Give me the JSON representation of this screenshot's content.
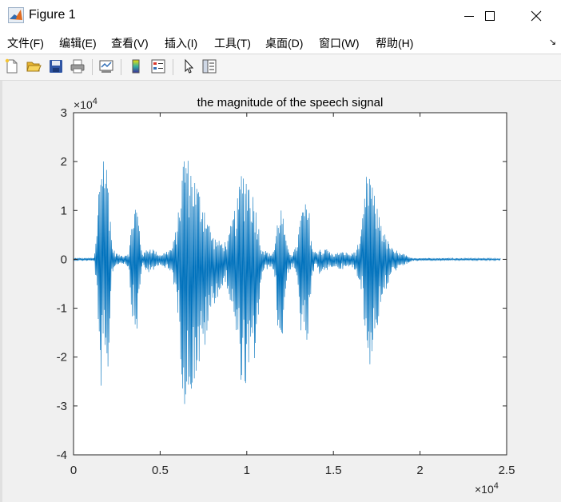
{
  "window": {
    "title": "Figure 1",
    "icon": "matlab-logo-icon",
    "controls": [
      "minimize-icon",
      "maximize-icon",
      "close-icon"
    ]
  },
  "menu": {
    "items": [
      "文件(F)",
      "编辑(E)",
      "查看(V)",
      "插入(I)",
      "工具(T)",
      "桌面(D)",
      "窗口(W)",
      "帮助(H)"
    ],
    "dock_glyph": "↘"
  },
  "toolbar": {
    "icons": [
      "new-figure-icon",
      "open-file-icon",
      "save-icon",
      "print-icon",
      "link-plot-icon",
      "colorbar-icon",
      "legend-icon",
      "edit-plot-arrow-icon",
      "property-editor-icon"
    ]
  },
  "colors": {
    "line": "#0072bd",
    "axes_bg": "#ffffff",
    "figure_bg": "#f0f0f0",
    "axis": "#262626"
  },
  "chart_data": {
    "type": "line",
    "title": "the magnitude of the speech signal",
    "xlabel": "",
    "ylabel": "",
    "xlim": [
      0,
      25000
    ],
    "ylim": [
      -40000,
      30000
    ],
    "x_ticks": [
      0,
      5000,
      10000,
      15000,
      20000,
      25000
    ],
    "x_tick_labels": [
      "0",
      "0.5",
      "1",
      "1.5",
      "2",
      "2.5"
    ],
    "y_ticks": [
      -40000,
      -30000,
      -20000,
      -10000,
      0,
      10000,
      20000,
      30000
    ],
    "y_tick_labels": [
      "-4",
      "-3",
      "-2",
      "-1",
      "0",
      "1",
      "2",
      "3"
    ],
    "x_exponent": {
      "base": "×10",
      "exp": "4"
    },
    "y_exponent": {
      "base": "×10",
      "exp": "4"
    },
    "grid": false,
    "sample_count": 24650,
    "envelope": {
      "x": [
        0,
        1200,
        1350,
        1500,
        1700,
        1800,
        1900,
        2000,
        2100,
        2200,
        2400,
        2700,
        3000,
        3200,
        3400,
        3600,
        3700,
        3800,
        3900,
        4000,
        4200,
        4500,
        4800,
        5000,
        5300,
        5700,
        6000,
        6200,
        6400,
        6600,
        6800,
        7000,
        7300,
        7600,
        7800,
        8000,
        8300,
        8600,
        8900,
        9200,
        9500,
        9700,
        10000,
        10200,
        10400,
        10600,
        10800,
        11000,
        11200,
        11400,
        11600,
        11800,
        12000,
        12300,
        12600,
        12900,
        13100,
        13300,
        13600,
        13800,
        14000,
        14200,
        14400,
        14600,
        14800,
        15000,
        15300,
        15700,
        16000,
        16300,
        16600,
        16900,
        17100,
        17300,
        17500,
        17700,
        17900,
        18100,
        18300,
        18500,
        18700,
        18900,
        19100,
        19300,
        19500,
        20000,
        24650
      ],
      "max": [
        300,
        300,
        6000,
        19000,
        24000,
        22000,
        20000,
        17000,
        13000,
        3000,
        1500,
        800,
        1000,
        1500,
        9000,
        12000,
        10000,
        7000,
        3000,
        1000,
        2000,
        2500,
        1500,
        1000,
        1500,
        2500,
        8000,
        15000,
        24000,
        21000,
        19000,
        17000,
        14000,
        11000,
        8000,
        5000,
        4000,
        3500,
        4000,
        9000,
        13000,
        19000,
        18000,
        16000,
        13000,
        10000,
        3000,
        2000,
        1500,
        1000,
        2500,
        9000,
        11000,
        3000,
        1000,
        3000,
        9000,
        12000,
        10000,
        2000,
        1500,
        2500,
        1500,
        2500,
        1500,
        1000,
        1500,
        1500,
        1000,
        2000,
        5000,
        17000,
        19000,
        14000,
        11000,
        9000,
        6000,
        4000,
        3000,
        1500,
        2000,
        1000,
        1200,
        500,
        300,
        300,
        200
      ],
      "min": [
        -300,
        -300,
        -8000,
        -25000,
        -28000,
        -27000,
        -26000,
        -23000,
        -15000,
        -3000,
        -1500,
        -800,
        -1000,
        -2000,
        -13000,
        -16000,
        -14000,
        -9000,
        -3000,
        -1000,
        -2500,
        -3000,
        -1500,
        -1000,
        -2000,
        -3000,
        -10000,
        -22000,
        -31000,
        -29000,
        -27000,
        -25000,
        -22000,
        -18000,
        -14000,
        -10000,
        -8000,
        -6000,
        -6000,
        -12000,
        -20000,
        -26000,
        -27000,
        -25000,
        -22000,
        -17000,
        -5000,
        -2500,
        -2000,
        -1500,
        -3000,
        -15000,
        -20000,
        -4000,
        -1500,
        -4000,
        -14000,
        -20000,
        -16000,
        -3000,
        -2000,
        -3000,
        -2000,
        -3000,
        -2000,
        -1500,
        -2000,
        -2000,
        -1500,
        -2500,
        -6000,
        -19000,
        -22000,
        -18000,
        -15000,
        -11000,
        -8000,
        -6000,
        -4000,
        -2000,
        -2500,
        -1500,
        -1500,
        -800,
        -400,
        -300,
        -200
      ]
    }
  }
}
